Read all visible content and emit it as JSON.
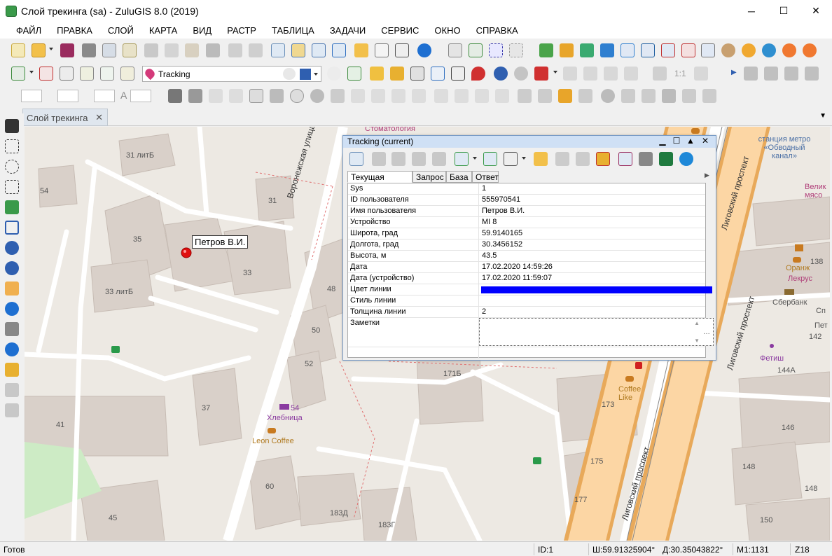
{
  "window": {
    "title": "Слой трекинга (sa) - ZuluGIS 8.0 (2019)",
    "controls": {
      "minimize": "─",
      "maximize": "☐",
      "close": "✕"
    }
  },
  "menu": [
    "ФАЙЛ",
    "ПРАВКА",
    "СЛОЙ",
    "КАРТА",
    "ВИД",
    "РАСТР",
    "ТАБЛИЦА",
    "ЗАДАЧИ",
    "СЕРВИС",
    "ОКНО",
    "СПРАВКА"
  ],
  "toolbar2": {
    "layer_combo_value": "Tracking",
    "scale_label": "1:1"
  },
  "toolbar3": {
    "text_tool_glyph": "A"
  },
  "document_tab": {
    "label": "Слой трекинга",
    "close": "✕"
  },
  "map": {
    "marker_label": "Петров В.И.",
    "street_labels": {
      "voronezhskaya": "Воронежская улица",
      "ligovsky_1": "Лиговский проспект",
      "ligovsky_2": "Лиговский проспект",
      "ligovsky_3": "Лиговский проспект"
    },
    "building_numbers": [
      "31 литБ",
      "54",
      "31",
      "35",
      "33",
      "33 литБ",
      "48",
      "50",
      "52",
      "37",
      "41",
      "60",
      "45",
      "183Д",
      "183Г",
      "171Б",
      "173",
      "175",
      "177",
      "138",
      "142",
      "144А",
      "146",
      "148",
      "148",
      "150"
    ],
    "poi": {
      "metro": "станция метро «Обводный канал»",
      "khlebnitsa_num": "54",
      "khlebnitsa": "Хлебница",
      "leon": "Leon Coffee",
      "coffee_like": "Coffee Like",
      "orange": "Оранж",
      "lekrus": "Лекрус",
      "sberbank": "Сбербанк",
      "fetish": "Фетиш",
      "velikie": "Велик мясо",
      "stomatology": "Стоматология",
      "partial_sp": "Сп",
      "partial_pet": "Пет"
    }
  },
  "tracking_window": {
    "title": "Tracking (current)",
    "controls": {
      "minimize": "▁",
      "maximize": "☐",
      "up": "▲",
      "close": "✕"
    },
    "tabs": [
      "Текущая запись",
      "Запрос",
      "База",
      "Ответ"
    ],
    "rows": [
      {
        "key": "Sys",
        "value": "1"
      },
      {
        "key": "ID пользователя",
        "value": "555970541"
      },
      {
        "key": "Имя пользователя",
        "value": "Петров В.И."
      },
      {
        "key": "Устройство",
        "value": "MI 8"
      },
      {
        "key": "Широта, град",
        "value": "59.9140165"
      },
      {
        "key": "Долгота, град",
        "value": "30.3456152"
      },
      {
        "key": "Высота, м",
        "value": "43.5"
      },
      {
        "key": "Дата",
        "value": "17.02.2020 14:59:26"
      },
      {
        "key": "Дата (устройство)",
        "value": "17.02.2020 11:59:07"
      },
      {
        "key": "Цвет линии",
        "value": ""
      },
      {
        "key": "Стиль линии",
        "value": ""
      },
      {
        "key": "Толщина линии",
        "value": "2"
      },
      {
        "key": "Заметки",
        "value": ""
      }
    ],
    "line_color": "#0000ff"
  },
  "status_bar": {
    "state": "Готов",
    "id": "ID:1",
    "lat": "Ш:59.91325904°",
    "lon": "Д:30.35043822°",
    "scale": "М1:1131",
    "zoom": "Z18"
  },
  "colors": {
    "map_bg": "#ede9e3",
    "building": "#d9d0c9",
    "road": "#ffffff",
    "avenue": "#fcd6a4",
    "avenue_border": "#e8a95a",
    "marker": "#e01010",
    "title_active": "#cfe0f5"
  }
}
